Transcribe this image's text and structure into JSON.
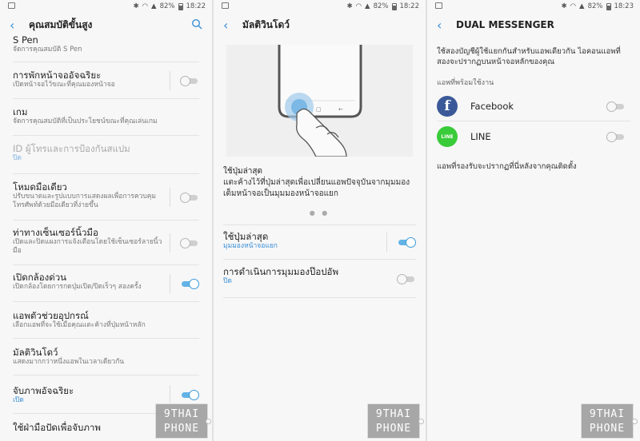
{
  "status": {
    "battery": "82%",
    "screen1_time": "18:22",
    "screen2_time": "18:22",
    "screen3_time": "18:23"
  },
  "screen1": {
    "title": "คุณสมบัติขั้นสูง",
    "items": [
      {
        "title": "S Pen",
        "sub": "จัดการคุณสมบัติ S Pen"
      },
      {
        "title": "การพักหน้าจออัจฉริยะ",
        "sub": "เปิดหน้าจอไว้ขณะที่คุณมองหน้าจอ"
      },
      {
        "title": "เกม",
        "sub": "จัดการคุณสมบัติที่เป็นประโยชน์ขณะที่คุณเล่นเกม"
      },
      {
        "title": "ID ผู้โทรและการป้องกันสแปม",
        "sub": "ปิด"
      },
      {
        "title": "โหมดมือเดียว",
        "sub": "ปรับขนาดและรูปแบบการแสดงผลเพื่อการควบคุมโทรศัพท์ด้วยมือเดียวที่ง่ายขึ้น"
      },
      {
        "title": "ท่าทางเซ็นเซอร์นิ้วมือ",
        "sub": "เปิดและปิดแผงการแจ้งเตือนโดยใช้เซ็นเซอร์ลายนิ้วมือ"
      },
      {
        "title": "เปิดกล้องด่วน",
        "sub": "เปิดกล้องโดยการกดปุ่มเปิด/ปิดเร็วๆ สองครั้ง"
      },
      {
        "title": "แอพตัวช่วยอุปกรณ์",
        "sub": "เลือกแอพที่จะใช้เมื่อคุณแตะค้างที่ปุ่มหน้าหลัก"
      },
      {
        "title": "มัลติวินโดว์",
        "sub": "แสดงมากกว่าหนึ่งแอพในเวลาเดียวกัน"
      },
      {
        "title": "จับภาพอัจฉริยะ",
        "sub": "เปิด"
      },
      {
        "title": "ใช้ฝ่ามือปัดเพื่อจับภาพ",
        "sub": ""
      }
    ]
  },
  "screen2": {
    "title": "มัลติวินโดว์",
    "desc_title": "ใช้ปุ่มล่าสุด",
    "desc_body": "แตะค้างไว้ที่ปุ่มล่าสุดเพื่อเปลี่ยนแอพปัจจุบันจากมุมมองเต็มหน้าจอเป็นมุมมองหน้าจอแยก",
    "items": [
      {
        "title": "ใช้ปุ่มล่าสุด",
        "sub": "มุมมองหน้าจอแยก"
      },
      {
        "title": "การดำเนินการมุมมองป๊อปอัพ",
        "sub": "ปิด"
      }
    ]
  },
  "screen3": {
    "title": "DUAL MESSENGER",
    "intro": "ใช้สองบัญชีผู้ใช้แยกกันสำหรับแอพเดียวกัน ไอคอนแอพที่สองจะปรากฏบนหน้าจอหลักของคุณ",
    "section": "แอพที่พร้อมใช้งาน",
    "apps": [
      {
        "name": "Facebook",
        "icon": "facebook-icon",
        "color": "#3b5998",
        "glyph": "f"
      },
      {
        "name": "LINE",
        "icon": "line-icon",
        "color": "#3acb3a",
        "glyph": "LINE"
      }
    ],
    "footer": "แอพที่รองรับจะปรากฏที่นี่หลังจากคุณติดตั้ง"
  },
  "watermark": {
    "line1": "9THAI",
    "line2": "PHONE"
  },
  "colors": {
    "accent": "#3a8fd6",
    "toggle_on": "#63b3e6"
  }
}
